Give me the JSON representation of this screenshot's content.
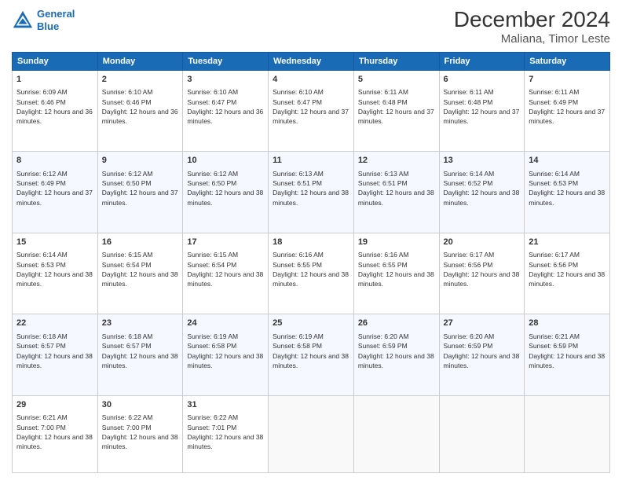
{
  "header": {
    "logo_line1": "General",
    "logo_line2": "Blue",
    "title": "December 2024",
    "subtitle": "Maliana, Timor Leste"
  },
  "days_of_week": [
    "Sunday",
    "Monday",
    "Tuesday",
    "Wednesday",
    "Thursday",
    "Friday",
    "Saturday"
  ],
  "weeks": [
    [
      {
        "day": "1",
        "sunrise": "6:09 AM",
        "sunset": "6:46 PM",
        "daylight": "12 hours and 36 minutes."
      },
      {
        "day": "2",
        "sunrise": "6:10 AM",
        "sunset": "6:46 PM",
        "daylight": "12 hours and 36 minutes."
      },
      {
        "day": "3",
        "sunrise": "6:10 AM",
        "sunset": "6:47 PM",
        "daylight": "12 hours and 36 minutes."
      },
      {
        "day": "4",
        "sunrise": "6:10 AM",
        "sunset": "6:47 PM",
        "daylight": "12 hours and 37 minutes."
      },
      {
        "day": "5",
        "sunrise": "6:11 AM",
        "sunset": "6:48 PM",
        "daylight": "12 hours and 37 minutes."
      },
      {
        "day": "6",
        "sunrise": "6:11 AM",
        "sunset": "6:48 PM",
        "daylight": "12 hours and 37 minutes."
      },
      {
        "day": "7",
        "sunrise": "6:11 AM",
        "sunset": "6:49 PM",
        "daylight": "12 hours and 37 minutes."
      }
    ],
    [
      {
        "day": "8",
        "sunrise": "6:12 AM",
        "sunset": "6:49 PM",
        "daylight": "12 hours and 37 minutes."
      },
      {
        "day": "9",
        "sunrise": "6:12 AM",
        "sunset": "6:50 PM",
        "daylight": "12 hours and 37 minutes."
      },
      {
        "day": "10",
        "sunrise": "6:12 AM",
        "sunset": "6:50 PM",
        "daylight": "12 hours and 38 minutes."
      },
      {
        "day": "11",
        "sunrise": "6:13 AM",
        "sunset": "6:51 PM",
        "daylight": "12 hours and 38 minutes."
      },
      {
        "day": "12",
        "sunrise": "6:13 AM",
        "sunset": "6:51 PM",
        "daylight": "12 hours and 38 minutes."
      },
      {
        "day": "13",
        "sunrise": "6:14 AM",
        "sunset": "6:52 PM",
        "daylight": "12 hours and 38 minutes."
      },
      {
        "day": "14",
        "sunrise": "6:14 AM",
        "sunset": "6:53 PM",
        "daylight": "12 hours and 38 minutes."
      }
    ],
    [
      {
        "day": "15",
        "sunrise": "6:14 AM",
        "sunset": "6:53 PM",
        "daylight": "12 hours and 38 minutes."
      },
      {
        "day": "16",
        "sunrise": "6:15 AM",
        "sunset": "6:54 PM",
        "daylight": "12 hours and 38 minutes."
      },
      {
        "day": "17",
        "sunrise": "6:15 AM",
        "sunset": "6:54 PM",
        "daylight": "12 hours and 38 minutes."
      },
      {
        "day": "18",
        "sunrise": "6:16 AM",
        "sunset": "6:55 PM",
        "daylight": "12 hours and 38 minutes."
      },
      {
        "day": "19",
        "sunrise": "6:16 AM",
        "sunset": "6:55 PM",
        "daylight": "12 hours and 38 minutes."
      },
      {
        "day": "20",
        "sunrise": "6:17 AM",
        "sunset": "6:56 PM",
        "daylight": "12 hours and 38 minutes."
      },
      {
        "day": "21",
        "sunrise": "6:17 AM",
        "sunset": "6:56 PM",
        "daylight": "12 hours and 38 minutes."
      }
    ],
    [
      {
        "day": "22",
        "sunrise": "6:18 AM",
        "sunset": "6:57 PM",
        "daylight": "12 hours and 38 minutes."
      },
      {
        "day": "23",
        "sunrise": "6:18 AM",
        "sunset": "6:57 PM",
        "daylight": "12 hours and 38 minutes."
      },
      {
        "day": "24",
        "sunrise": "6:19 AM",
        "sunset": "6:58 PM",
        "daylight": "12 hours and 38 minutes."
      },
      {
        "day": "25",
        "sunrise": "6:19 AM",
        "sunset": "6:58 PM",
        "daylight": "12 hours and 38 minutes."
      },
      {
        "day": "26",
        "sunrise": "6:20 AM",
        "sunset": "6:59 PM",
        "daylight": "12 hours and 38 minutes."
      },
      {
        "day": "27",
        "sunrise": "6:20 AM",
        "sunset": "6:59 PM",
        "daylight": "12 hours and 38 minutes."
      },
      {
        "day": "28",
        "sunrise": "6:21 AM",
        "sunset": "6:59 PM",
        "daylight": "12 hours and 38 minutes."
      }
    ],
    [
      {
        "day": "29",
        "sunrise": "6:21 AM",
        "sunset": "7:00 PM",
        "daylight": "12 hours and 38 minutes."
      },
      {
        "day": "30",
        "sunrise": "6:22 AM",
        "sunset": "7:00 PM",
        "daylight": "12 hours and 38 minutes."
      },
      {
        "day": "31",
        "sunrise": "6:22 AM",
        "sunset": "7:01 PM",
        "daylight": "12 hours and 38 minutes."
      },
      null,
      null,
      null,
      null
    ]
  ],
  "labels": {
    "sunrise": "Sunrise: ",
    "sunset": "Sunset: ",
    "daylight": "Daylight: "
  }
}
